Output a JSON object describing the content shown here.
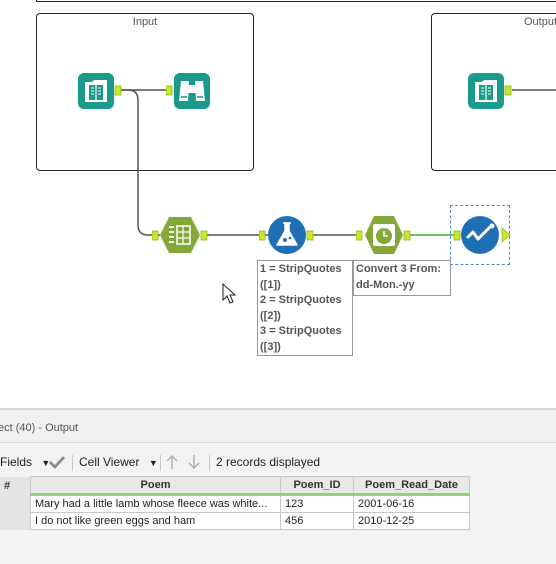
{
  "canvas": {
    "containers": [
      {
        "title": "Input"
      },
      {
        "title": "Output"
      }
    ],
    "annotations": {
      "formula_lines": [
        "1 = StripQuotes",
        "([1])",
        "2 = StripQuotes",
        "([2])",
        "3 = StripQuotes",
        "([3])"
      ],
      "datetime_lines": [
        "Convert 3 From:",
        "dd-Mon.-yy"
      ]
    },
    "colors": {
      "input_tool": "#1a9a8a",
      "preparation_tool": "#84a83a",
      "formula_tool": "#1f6fb5",
      "connector": "#555555",
      "connector_active": "#3aa83a",
      "anchor": "#c8e830"
    }
  },
  "results": {
    "title": "ect (40) - Output",
    "toolbar": {
      "fields_label": "Fields",
      "viewer_label": "Cell Viewer",
      "records_text": "2 records displayed"
    },
    "table": {
      "rownum_header": "#",
      "columns": [
        "Poem",
        "Poem_ID",
        "Poem_Read_Date"
      ],
      "rows": [
        [
          "Mary had a little lamb whose fleece was white...",
          "123",
          "2001-06-16"
        ],
        [
          "I do not like green eggs and ham",
          "456",
          "2010-12-25"
        ]
      ]
    }
  }
}
